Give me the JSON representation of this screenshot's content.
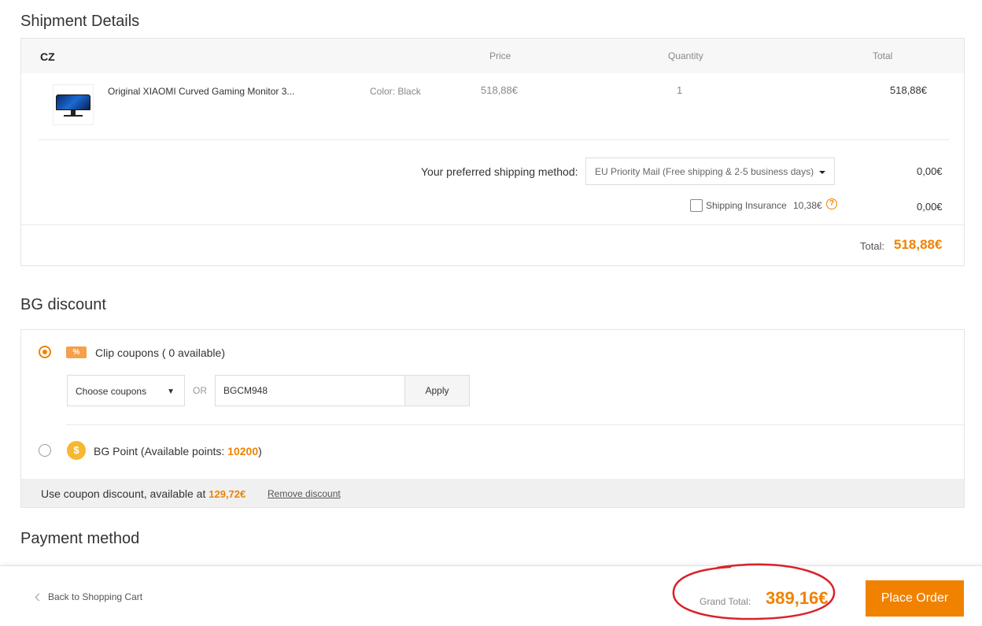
{
  "shipment": {
    "title": "Shipment Details",
    "country": "CZ",
    "columns": {
      "price": "Price",
      "quantity": "Quantity",
      "total": "Total"
    },
    "product": {
      "name": "Original XIAOMI Curved Gaming Monitor 3...",
      "color": "Color: Black",
      "price": "518,88€",
      "quantity": "1",
      "total": "518,88€"
    },
    "shipping_label": "Your preferred shipping method:",
    "shipping_method": "EU Priority Mail (Free shipping & 2-5 business days)",
    "shipping_cost": "0,00€",
    "insurance_label": "Shipping Insurance",
    "insurance_price": "10,38€",
    "insurance_checked": false,
    "insurance_cost": "0,00€",
    "total_label": "Total:",
    "total_value": "518,88€"
  },
  "discount": {
    "title": "BG discount",
    "clip_label": "Clip coupons ( 0 available)",
    "coupon_select": "Choose coupons",
    "or_text": "OR",
    "coupon_code": "BGCM948",
    "apply_label": "Apply",
    "point_label_prefix": "BG Point (Available points: ",
    "points": "10200",
    "point_label_suffix": ")",
    "footer_text": "Use coupon discount, available at ",
    "footer_value": "129,72€",
    "remove_label": "Remove discount"
  },
  "payment": {
    "title": "Payment method"
  },
  "bottom": {
    "back_label": "Back to Shopping Cart",
    "grand_total_label": "Grand Total:",
    "grand_total_value": "389,16€",
    "place_order_label": "Place Order"
  },
  "colors": {
    "accent": "#f08200",
    "annotation": "#d8232a"
  }
}
